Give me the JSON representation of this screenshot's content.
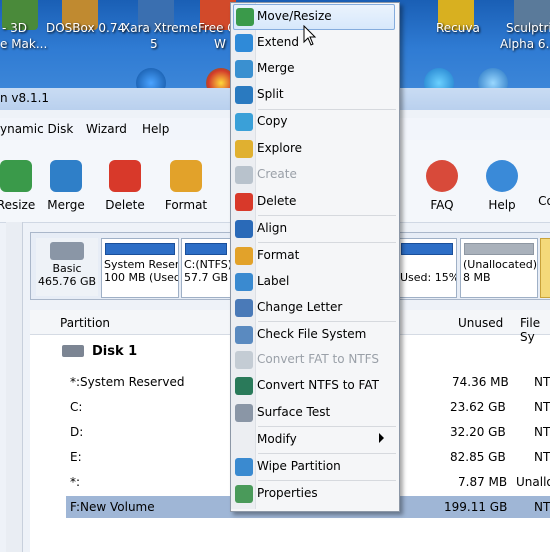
{
  "desktop": {
    "icons": [
      {
        "label1": "- 3D",
        "label2": "e Mak..."
      },
      {
        "label1": "DOSBox 0.74",
        "label2": ""
      },
      {
        "label1": "Xara Xtreme",
        "label2": "5"
      },
      {
        "label1": "Free O",
        "label2": "W"
      },
      {
        "label1": "Recuva",
        "label2": ""
      },
      {
        "label1": "Sculptri",
        "label2": "Alpha 6.e"
      }
    ]
  },
  "window": {
    "title": "n v8.1.1"
  },
  "menubar": [
    "ynamic Disk",
    "Wizard",
    "Help"
  ],
  "toolbar": {
    "left": [
      "Resize",
      "Merge",
      "Delete",
      "Format"
    ],
    "right": [
      "FAQ",
      "Help",
      "Co"
    ]
  },
  "diskmap": {
    "disk_label": "Basic",
    "disk_size": "465.76 GB",
    "partitions": [
      {
        "name": "System Reserv",
        "info": "100 MB (Used:"
      },
      {
        "name": "C:(NTFS)",
        "info": "57.7 GB (U"
      },
      {
        "name": "",
        "info": "Used: 15%"
      },
      {
        "name": "(Unallocated)",
        "info": "8 MB"
      }
    ]
  },
  "table": {
    "headers": {
      "partition": "Partition",
      "unused": "Unused",
      "filesystem": "File Sy"
    },
    "disk_row": "Disk 1",
    "rows": [
      {
        "partition": "*:System Reserved",
        "unused": "74.36 MB",
        "fs": "NT"
      },
      {
        "partition": "C:",
        "unused": "23.62 GB",
        "fs": "NT"
      },
      {
        "partition": "D:",
        "unused": "32.20 GB",
        "fs": "NT"
      },
      {
        "partition": "E:",
        "unused": "82.85 GB",
        "fs": "NT"
      },
      {
        "partition": "*:",
        "unused": "7.87 MB",
        "fs": "Unallo"
      },
      {
        "partition": "F:New Volume",
        "unused": "199.11 GB",
        "fs": "NT"
      }
    ]
  },
  "context_menu": {
    "items": [
      {
        "label": "Move/Resize",
        "enabled": true,
        "icon": "move-resize-icon"
      },
      {
        "label": "Extend",
        "enabled": true,
        "icon": "extend-icon"
      },
      {
        "label": "Merge",
        "enabled": true,
        "icon": "merge-icon"
      },
      {
        "label": "Split",
        "enabled": true,
        "icon": "split-icon"
      },
      {
        "label": "Copy",
        "enabled": true,
        "icon": "copy-icon"
      },
      {
        "label": "Explore",
        "enabled": true,
        "icon": "explore-icon"
      },
      {
        "label": "Create",
        "enabled": false,
        "icon": "create-icon"
      },
      {
        "label": "Delete",
        "enabled": true,
        "icon": "delete-icon"
      },
      {
        "label": "Align",
        "enabled": true,
        "icon": "align-icon"
      },
      {
        "label": "Format",
        "enabled": true,
        "icon": "format-icon"
      },
      {
        "label": "Label",
        "enabled": true,
        "icon": "label-icon"
      },
      {
        "label": "Change Letter",
        "enabled": true,
        "icon": "change-letter-icon"
      },
      {
        "label": "Check File System",
        "enabled": true,
        "icon": "check-fs-icon"
      },
      {
        "label": "Convert FAT to NTFS",
        "enabled": false,
        "icon": "fat-icon"
      },
      {
        "label": "Convert NTFS to FAT",
        "enabled": true,
        "icon": "ntfs-icon"
      },
      {
        "label": "Surface Test",
        "enabled": true,
        "icon": "surface-test-icon"
      },
      {
        "label": "Modify",
        "enabled": true,
        "icon": "",
        "submenu": true
      },
      {
        "label": "Wipe Partition",
        "enabled": true,
        "icon": "wipe-icon"
      },
      {
        "label": "Properties",
        "enabled": true,
        "icon": "properties-icon"
      }
    ]
  },
  "colors": {
    "accent": "#2d6ec6",
    "highlight": "#d7e8fb",
    "disabled_text": "#9aa0a8"
  }
}
